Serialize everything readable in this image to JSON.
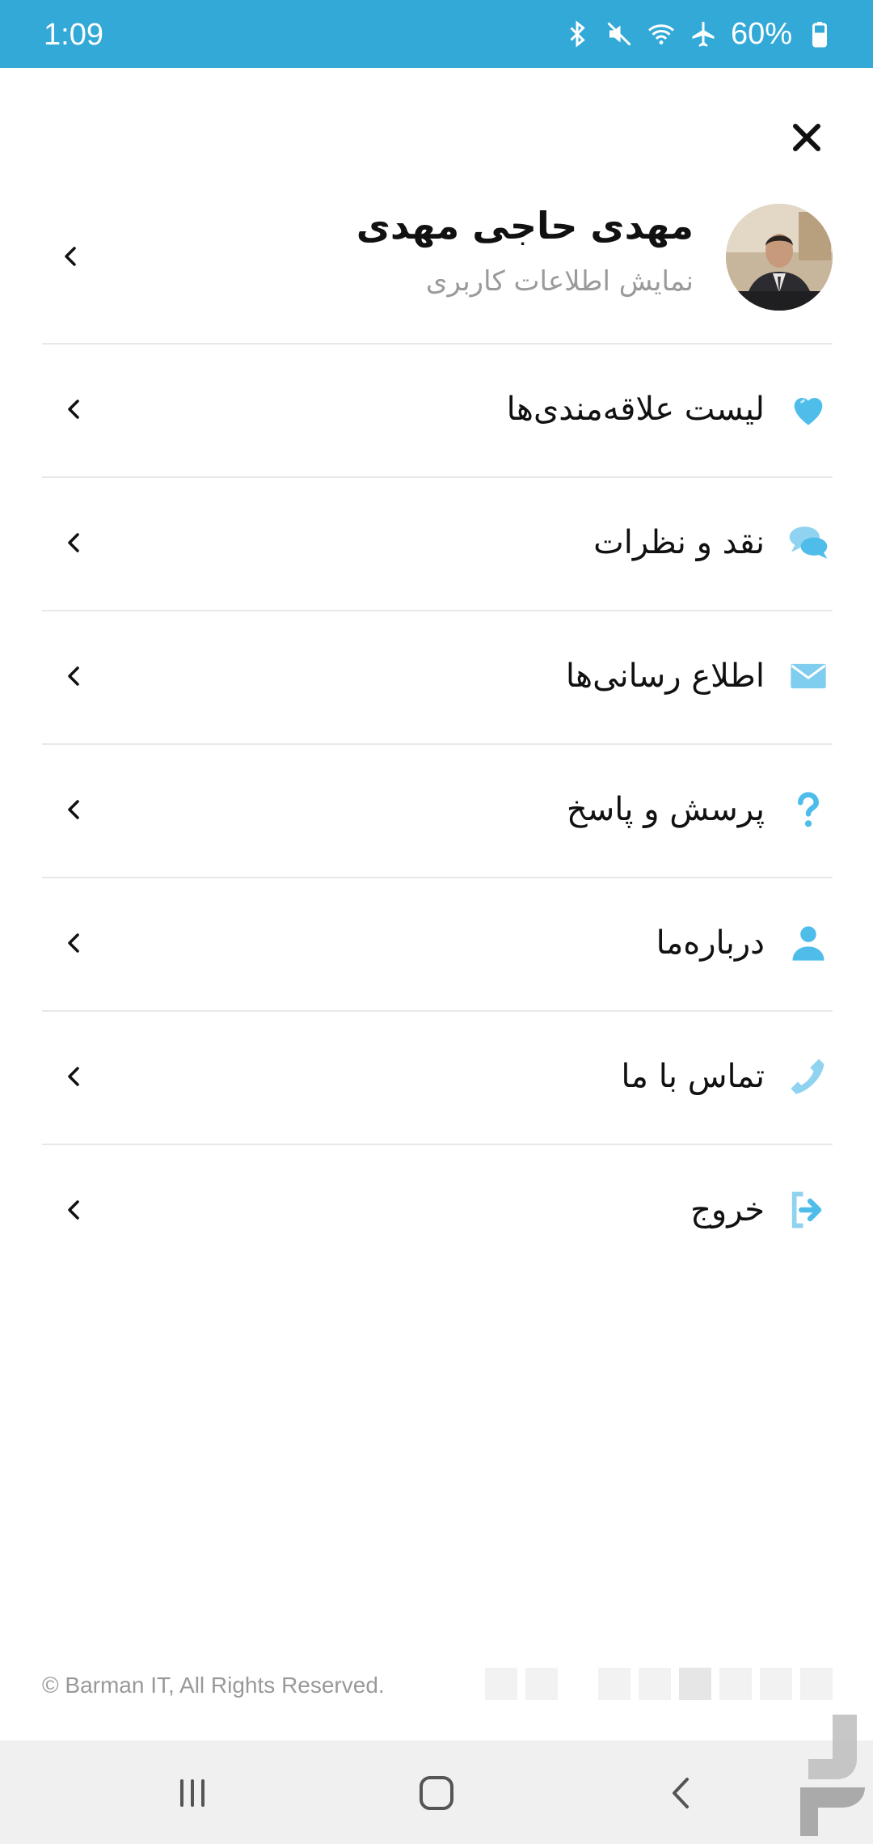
{
  "status_bar": {
    "time": "1:09",
    "battery": "60%",
    "icons": [
      "bluetooth-icon",
      "mute-icon",
      "wifi-icon",
      "airplane-icon",
      "battery-icon"
    ]
  },
  "profile": {
    "name": "مهدی حاجی مهدی",
    "subtitle": "نمایش اطلاعات کاربری"
  },
  "menu": {
    "items": [
      {
        "label": "لیست علاقه‌مندی‌ها",
        "icon": "heart-icon"
      },
      {
        "label": "نقد و نظرات",
        "icon": "comments-icon"
      },
      {
        "label": "اطلاع رسانی‌ها",
        "icon": "envelope-icon"
      },
      {
        "label": "پرسش و پاسخ",
        "icon": "question-icon"
      },
      {
        "label": "درباره‌ما",
        "icon": "user-icon"
      },
      {
        "label": "تماس با ما",
        "icon": "phone-icon"
      },
      {
        "label": "خروج",
        "icon": "logout-icon"
      }
    ]
  },
  "footer": {
    "copyright": "© Barman IT, All Rights Reserved."
  },
  "colors": {
    "accent": "#33a9d8",
    "icon": "#4fbde9",
    "divider": "#e8e8e8"
  }
}
